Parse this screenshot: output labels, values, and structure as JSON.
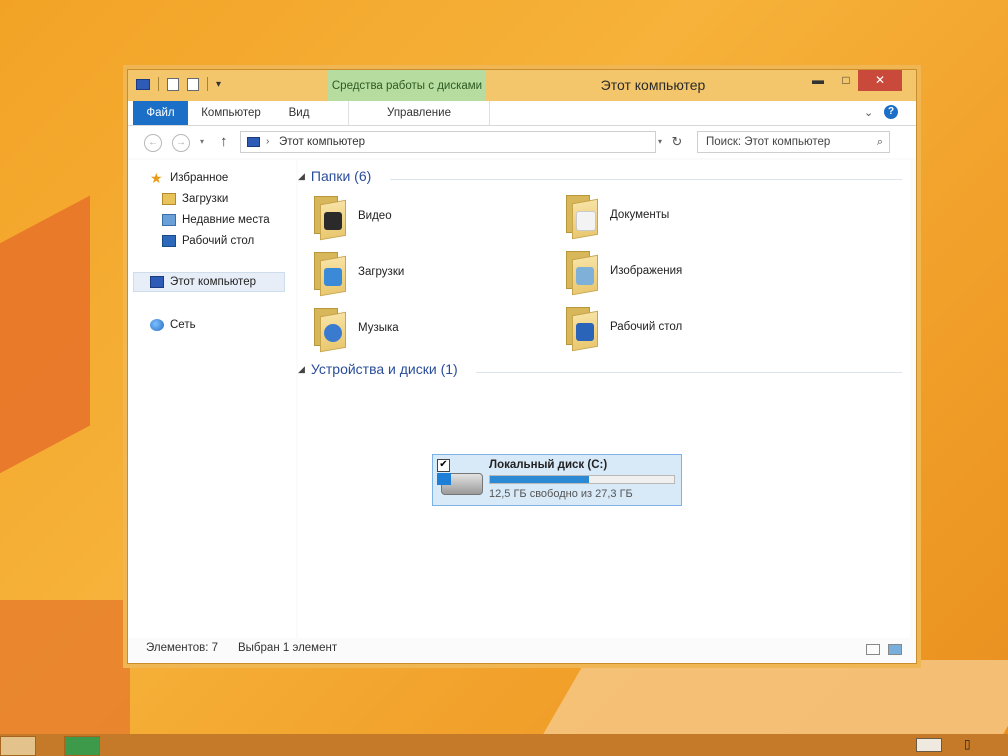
{
  "window": {
    "title": "Этот компьютер",
    "context_tab": "Средства работы с дисками",
    "controls": {
      "minimize": "▬",
      "maximize": "□",
      "close": "✕"
    }
  },
  "ribbon": {
    "tabs": [
      {
        "label": "Файл"
      },
      {
        "label": "Компьютер"
      },
      {
        "label": "Вид"
      },
      {
        "label": "Управление"
      }
    ],
    "help": "?"
  },
  "address": {
    "path": "Этот компьютер",
    "search_placeholder": "Поиск: Этот компьютер"
  },
  "sidebar": {
    "favorites": "Избранное",
    "favorite_items": [
      "Загрузки",
      "Недавние места",
      "Рабочий стол"
    ],
    "this_pc": "Этот компьютер",
    "network": "Сеть"
  },
  "content": {
    "folders_header": "Папки (6)",
    "folders": [
      {
        "label": "Видео",
        "icon": "video-folder-icon"
      },
      {
        "label": "Документы",
        "icon": "documents-folder-icon"
      },
      {
        "label": "Загрузки",
        "icon": "downloads-folder-icon"
      },
      {
        "label": "Изображения",
        "icon": "pictures-folder-icon"
      },
      {
        "label": "Музыка",
        "icon": "music-folder-icon"
      },
      {
        "label": "Рабочий стол",
        "icon": "desktop-folder-icon"
      }
    ],
    "devices_header": "Устройства и диски (1)",
    "drive": {
      "name": "Локальный диск (C:)",
      "free_text": "12,5 ГБ свободно из 27,3 ГБ",
      "used_fraction": 0.54
    }
  },
  "status": {
    "items_count": "Элементов: 7",
    "selected": "Выбран 1 элемент"
  },
  "colors": {
    "accent": "#1b6fc7",
    "titlebar": "#f4c66b",
    "context_tab": "#b6dca0"
  }
}
